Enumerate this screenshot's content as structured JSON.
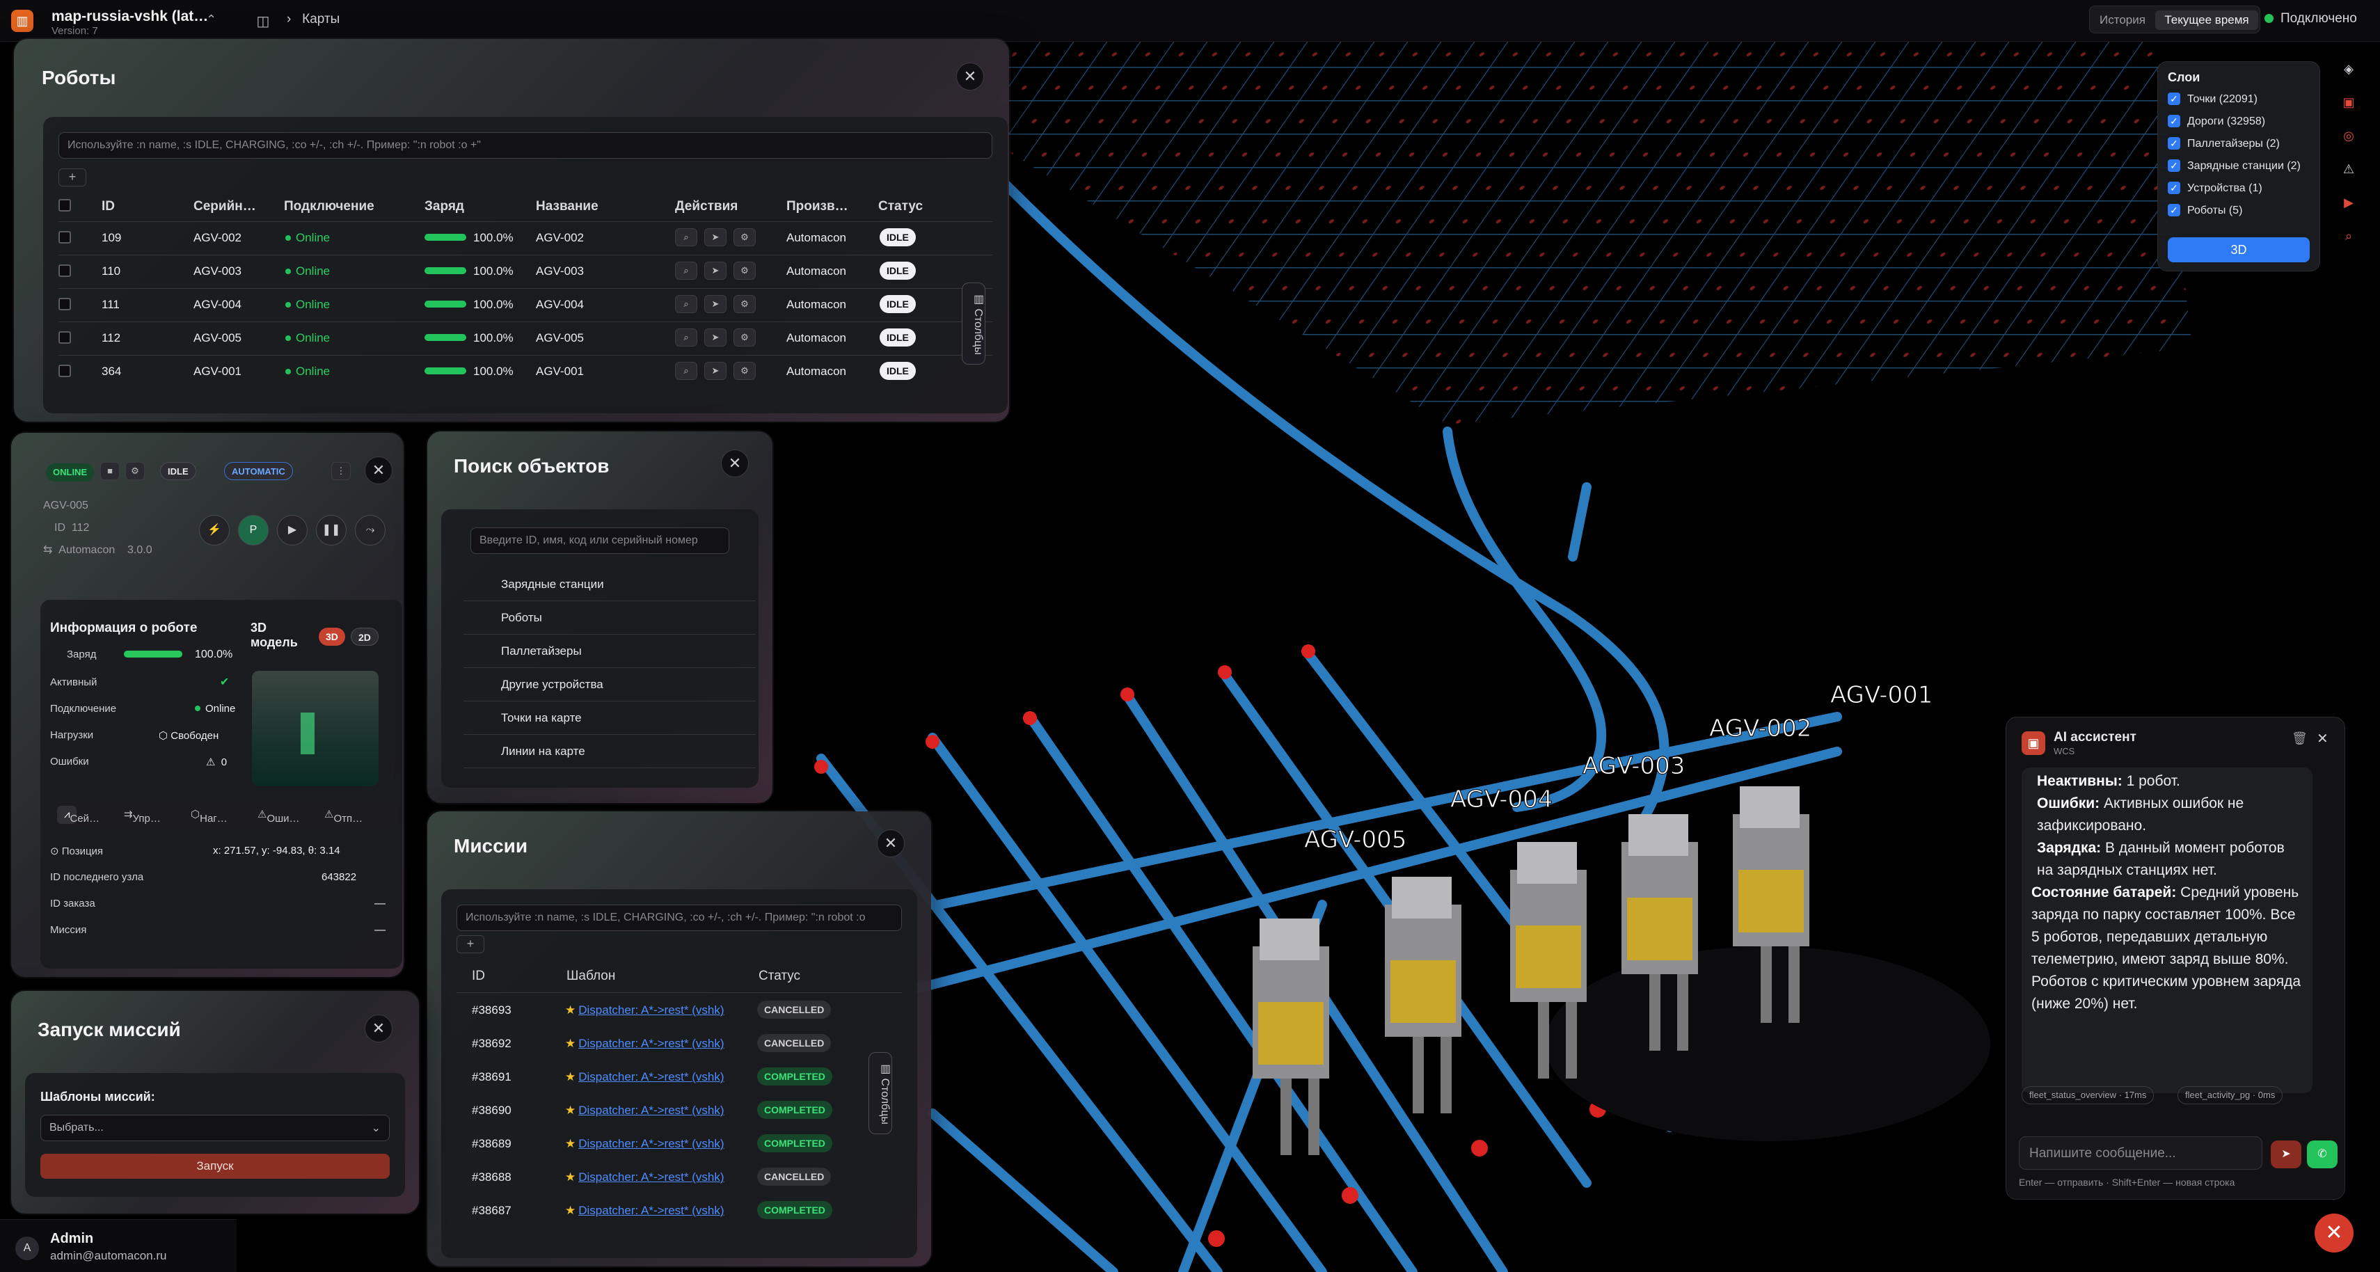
{
  "topbar": {
    "app_name": "map-russia-vshk (lat…",
    "version": "Version: 7",
    "breadcrumb": "Карты",
    "mode_history": "История",
    "mode_current": "Текущее время",
    "status": "Подключено"
  },
  "robots_panel": {
    "title": "Роботы",
    "search_placeholder": "Используйте :n name, :s IDLE, CHARGING, :co +/-, :ch +/-. Пример: \":n robot :o +\"",
    "add": "+",
    "columns_tab": "Столбцы",
    "headers": [
      "ID",
      "Серийн…",
      "Подключение",
      "Заряд",
      "Название",
      "Действия",
      "Произв…",
      "Статус"
    ],
    "rows": [
      {
        "id": "109",
        "serial": "AGV-002",
        "conn": "Online",
        "charge": "100.0%",
        "name": "AGV-002",
        "maker": "Automacon",
        "status": "IDLE"
      },
      {
        "id": "110",
        "serial": "AGV-003",
        "conn": "Online",
        "charge": "100.0%",
        "name": "AGV-003",
        "maker": "Automacon",
        "status": "IDLE"
      },
      {
        "id": "111",
        "serial": "AGV-004",
        "conn": "Online",
        "charge": "100.0%",
        "name": "AGV-004",
        "maker": "Automacon",
        "status": "IDLE"
      },
      {
        "id": "112",
        "serial": "AGV-005",
        "conn": "Online",
        "charge": "100.0%",
        "name": "AGV-005",
        "maker": "Automacon",
        "status": "IDLE"
      },
      {
        "id": "364",
        "serial": "AGV-001",
        "conn": "Online",
        "charge": "100.0%",
        "name": "AGV-001",
        "maker": "Automacon",
        "status": "IDLE"
      }
    ]
  },
  "robot_card": {
    "online": "ONLINE",
    "idle": "IDLE",
    "automatic": "AUTOMATIC",
    "name": "AGV-005",
    "id_label": "ID",
    "id": "112",
    "maker": "Automacon",
    "maker_version": "3.0.0",
    "info_title": "Информация о роботе",
    "model_title": "3D модель",
    "btn_3d": "3D",
    "btn_2d": "2D",
    "charge_label": "Заряд",
    "charge_value": "100.0%",
    "charge_level": 1.0,
    "active_label": "Активный",
    "conn_label": "Подключение",
    "conn_value": "Online",
    "load_label": "Нагрузки",
    "load_value": "Свободен",
    "errors_label": "Ошибки",
    "errors_value": "0",
    "tabs": [
      "Сей…",
      "Упр…",
      "Наг…",
      "Оши…",
      "Отп…"
    ],
    "position_label": "Позиция",
    "position_value": "x: 271.57, y: -94.83, θ: 3.14",
    "last_node_label": "ID последнего узла",
    "last_node_value": "643822",
    "order_label": "ID заказа",
    "order_value": "—",
    "mission_label": "Миссия",
    "mission_value": "—"
  },
  "search_panel": {
    "title": "Поиск объектов",
    "placeholder": "Введите ID, имя, код или серийный номер",
    "items": [
      "Зарядные станции",
      "Роботы",
      "Паллетайзеры",
      "Другие устройства",
      "Точки на карте",
      "Линии на карте"
    ]
  },
  "missions_panel": {
    "title": "Миссии",
    "search_placeholder": "Используйте :n name, :s IDLE, CHARGING, :co +/-, :ch +/-. Пример: \":n robot :o",
    "add": "+",
    "columns_tab": "Столбцы",
    "headers": [
      "ID",
      "Шаблон",
      "Статус"
    ],
    "rows": [
      {
        "id": "#38693",
        "template": "Dispatcher: A*->rest* (vshk)",
        "status": "CANCELLED"
      },
      {
        "id": "#38692",
        "template": "Dispatcher: A*->rest* (vshk)",
        "status": "CANCELLED"
      },
      {
        "id": "#38691",
        "template": "Dispatcher: A*->rest* (vshk)",
        "status": "COMPLETED"
      },
      {
        "id": "#38690",
        "template": "Dispatcher: A*->rest* (vshk)",
        "status": "COMPLETED"
      },
      {
        "id": "#38689",
        "template": "Dispatcher: A*->rest* (vshk)",
        "status": "COMPLETED"
      },
      {
        "id": "#38688",
        "template": "Dispatcher: A*->rest* (vshk)",
        "status": "CANCELLED"
      },
      {
        "id": "#38687",
        "template": "Dispatcher: A*->rest* (vshk)",
        "status": "COMPLETED"
      }
    ]
  },
  "launch_panel": {
    "title": "Запуск миссий",
    "templates_label": "Шаблоны миссий:",
    "select_placeholder": "Выбрать...",
    "launch": "Запуск"
  },
  "layers": {
    "title": "Слои",
    "items": [
      "Точки (22091)",
      "Дороги (32958)",
      "Паллетайзеры (2)",
      "Зарядные станции (2)",
      "Устройства (1)",
      "Роботы (5)"
    ],
    "btn_3d": "3D"
  },
  "map_labels": [
    "AGV-001",
    "AGV-002",
    "AGV-003",
    "AGV-004",
    "AGV-005"
  ],
  "ai": {
    "title": "AI ассистент",
    "subtitle": "WCS",
    "m1_b": "Неактивны:",
    "m1": " 1 робот.",
    "m2_b": "Ошибки:",
    "m2": " Активных ошибок не зафиксировано.",
    "m3_b": "Зарядка:",
    "m3": " В данный момент роботов на зарядных станциях нет.",
    "m4_b": "Состояние батарей:",
    "m4": " Средний уровень заряда по парку составляет 100%. Все 5 роботов, передавших детальную телеметрию, имеют заряд выше 80%. Роботов с критическим уровнем заряда (ниже 20%) нет.",
    "chip1": "fleet_status_overview · 17ms",
    "chip2": "fleet_activity_pg · 0ms",
    "input_placeholder": "Напишите сообщение...",
    "hint": "Enter — отправить · Shift+Enter — новая строка"
  },
  "user": {
    "initial": "A",
    "name": "Admin",
    "email": "admin@automacon.ru"
  }
}
